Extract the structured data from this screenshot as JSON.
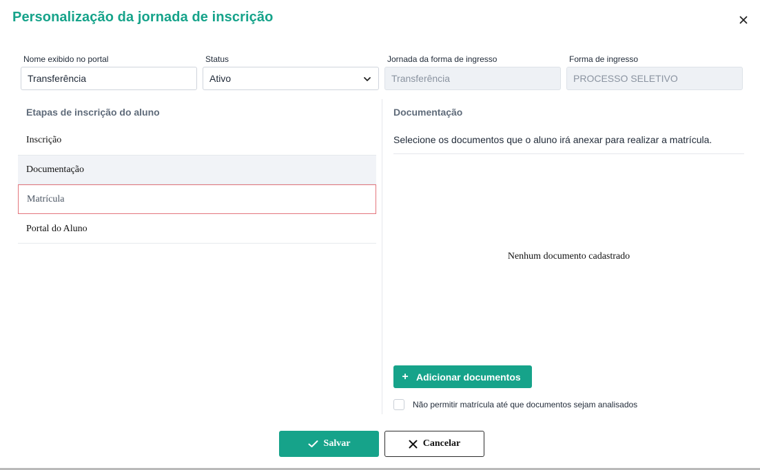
{
  "modal": {
    "title": "Personalização da jornada de inscrição",
    "close_icon": "close-icon"
  },
  "form": {
    "nome_label": "Nome exibido no portal",
    "nome_value": "Transferência",
    "status_label": "Status",
    "status_value": "Ativo",
    "jornada_label": "Jornada da forma de ingresso",
    "jornada_value": "Transferência",
    "forma_label": "Forma de ingresso",
    "forma_value": "PROCESSO SELETIVO"
  },
  "steps": {
    "heading": "Etapas de inscrição do aluno",
    "items": [
      {
        "label": "Inscrição",
        "state": "normal"
      },
      {
        "label": "Documentação",
        "state": "active"
      },
      {
        "label": "Matrícula",
        "state": "error"
      },
      {
        "label": "Portal do Aluno",
        "state": "normal"
      }
    ]
  },
  "documentacao": {
    "heading": "Documentação",
    "description": "Selecione os documentos que o aluno irá anexar para realizar a matrícula.",
    "empty_text": "Nenhum documento cadastrado",
    "add_button": "Adicionar documentos",
    "add_icon": "plus-icon",
    "checkbox_label": "Não permitir matrícula até que documentos sejam analisados",
    "checkbox_checked": false
  },
  "footer": {
    "save_label": "Salvar",
    "save_icon": "check-icon",
    "cancel_label": "Cancelar",
    "cancel_icon": "close-icon"
  },
  "colors": {
    "accent": "#16a38a",
    "error_border": "#e3747b",
    "active_bg": "#f1f3f7"
  }
}
